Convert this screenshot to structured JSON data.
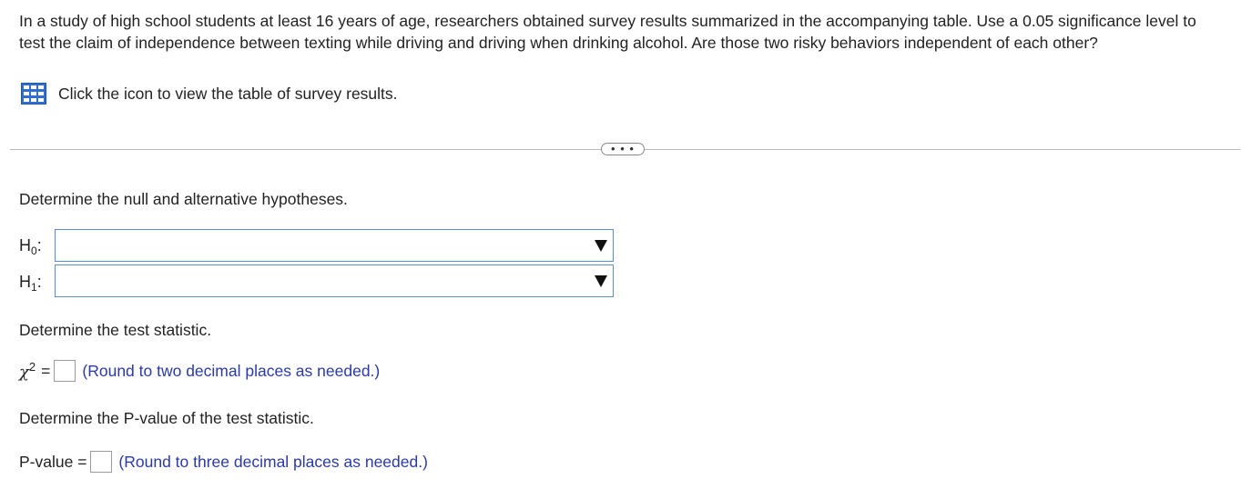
{
  "problem": {
    "text": "In a study of high school students at least 16 years of age, researchers obtained survey results summarized in the accompanying table. Use a 0.05 significance level to test the claim of independence between texting while driving and driving when drinking alcohol. Are those two risky behaviors independent of each other?"
  },
  "table_link": {
    "icon": "table-icon",
    "label": "Click the icon to view the table of survey results."
  },
  "expand_button": {
    "label": "• • •"
  },
  "hypotheses": {
    "prompt": "Determine the null and alternative hypotheses.",
    "h0_label": "H",
    "h0_sub": "0",
    "h1_label": "H",
    "h1_sub": "1",
    "h0_selected": "",
    "h1_selected": ""
  },
  "test_statistic": {
    "prompt": "Determine the test statistic.",
    "symbol": "χ",
    "superscript": "2",
    "equals": "=",
    "value": "",
    "hint": "(Round to two decimal places as needed.)"
  },
  "p_value": {
    "prompt": "Determine the P-value of the test statistic.",
    "label": "P-value =",
    "value": "",
    "hint": "(Round to three decimal places as needed.)"
  },
  "colors": {
    "select_border": "#5b8fd1",
    "hint_text": "#2a3aa8",
    "icon_blue": "#2f6fd1"
  }
}
